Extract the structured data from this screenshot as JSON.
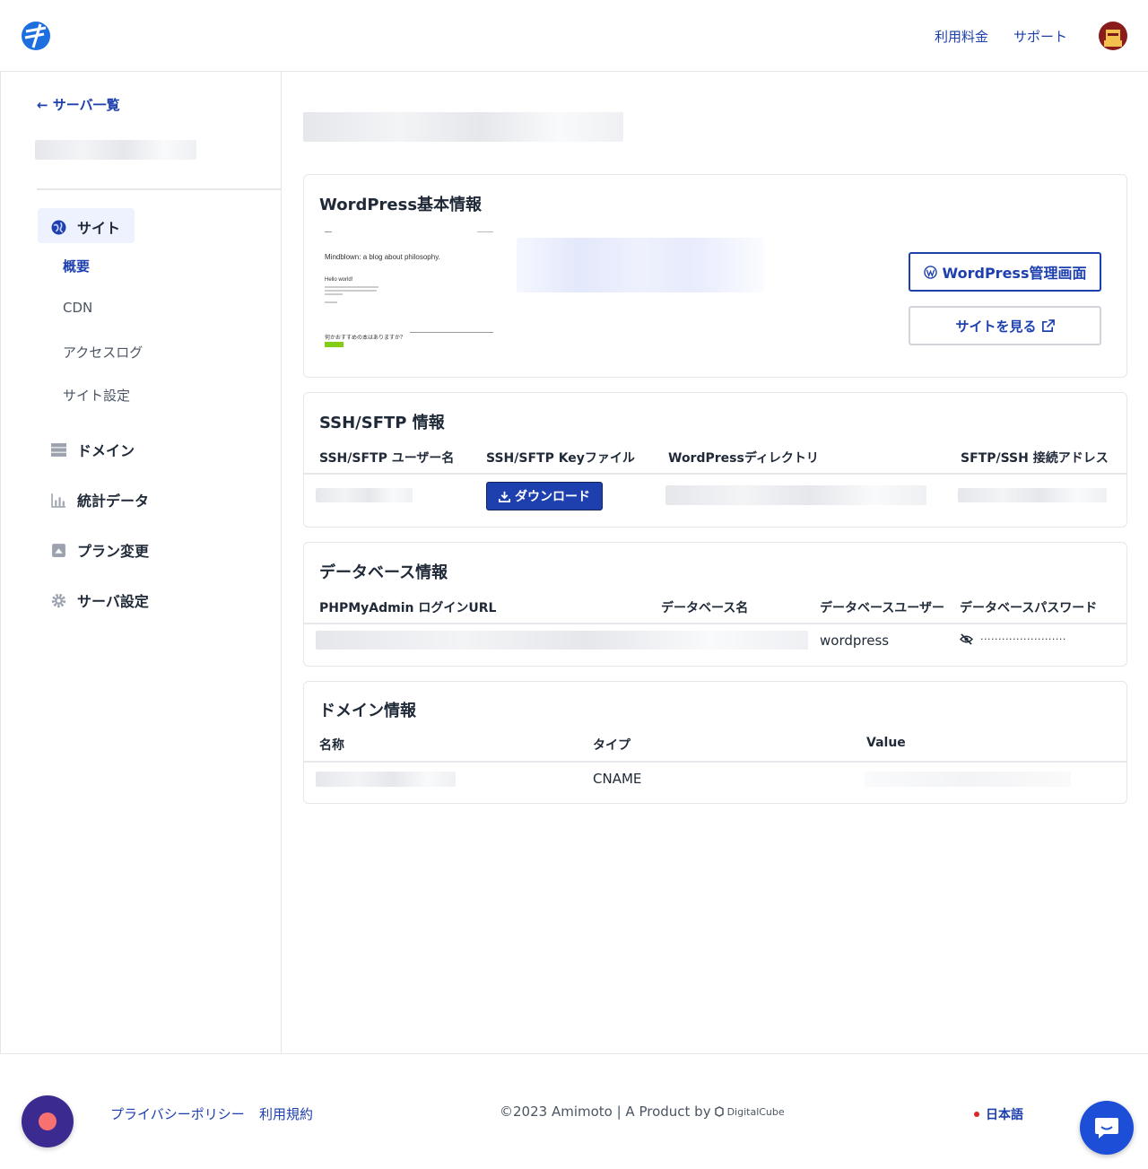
{
  "header": {
    "pricing_label": "利用料金",
    "support_label": "サポート"
  },
  "sidebar": {
    "back_label": "← サーバ一覧",
    "nav": {
      "site": "サイト",
      "sub": [
        "概要",
        "CDN",
        "アクセスログ",
        "サイト設定"
      ],
      "domain": "ドメイン",
      "stats": "統計データ",
      "plan": "プラン変更",
      "server_settings": "サーバ設定"
    }
  },
  "wp_info": {
    "title": "WordPress基本情報",
    "preview": {
      "blog_title": "Mindblown: a blog about philosophy.",
      "post_title": "Hello world!",
      "question": "何かおすすめの本はありますか？"
    },
    "admin_button": "WordPress管理画面",
    "view_site_button": "サイトを見る"
  },
  "ssh_info": {
    "title": "SSH/SFTP 情報",
    "columns": [
      "SSH/SFTP ユーザー名",
      "SSH/SFTP Keyファイル",
      "WordPressディレクトリ",
      "SFTP/SSH 接続アドレス"
    ],
    "download_button": "ダウンロード"
  },
  "db_info": {
    "title": "データベース情報",
    "columns": [
      "PHPMyAdmin ログインURL",
      "データベース名",
      "データベースユーザー",
      "データベースパスワード"
    ],
    "db_user": "wordpress",
    "password_mask": "························"
  },
  "domain_info": {
    "title": "ドメイン情報",
    "columns": [
      "名称",
      "タイプ",
      "Value"
    ],
    "type_value": "CNAME"
  },
  "footer": {
    "privacy": "プライバシーポリシー",
    "terms": "利用規約",
    "copyright": "©2023 Amimoto | A Product by",
    "brand": "DigitalCube",
    "language": "日本語"
  },
  "colors": {
    "accent": "#1e40af",
    "border": "#e5e7eb",
    "nav_active_bg": "#eef2ff"
  }
}
